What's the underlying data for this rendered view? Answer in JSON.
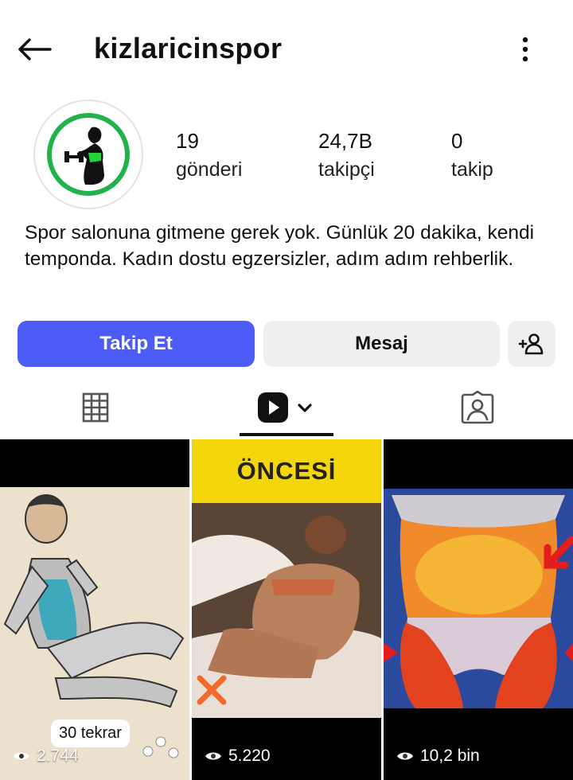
{
  "header": {
    "username": "kizlaricinspor"
  },
  "profile": {
    "stats": [
      {
        "value": "19",
        "label": "gönderi"
      },
      {
        "value": "24,7B",
        "label": "takipçi"
      },
      {
        "value": "0",
        "label": "takip"
      }
    ],
    "bio": "Spor salonuna gitmene gerek yok. Günlük 20 dakika, kendi temponda. Kadın dostu egzersizler, adım adım rehberlik."
  },
  "actions": {
    "follow_label": "Takip Et",
    "message_label": "Mesaj"
  },
  "colors": {
    "follow_button": "#4c5cf7",
    "secondary_button": "#efeff1",
    "avatar_ring": "#22b24c"
  },
  "tabs": {
    "icons": [
      "grid-icon",
      "reels-icon",
      "tagged-icon"
    ],
    "active": "reels"
  },
  "posts": [
    {
      "views": "2.744",
      "badge": "30 tekrar"
    },
    {
      "views": "5.220",
      "title": "ÖNCESİ"
    },
    {
      "views": "10,2 bin"
    }
  ]
}
